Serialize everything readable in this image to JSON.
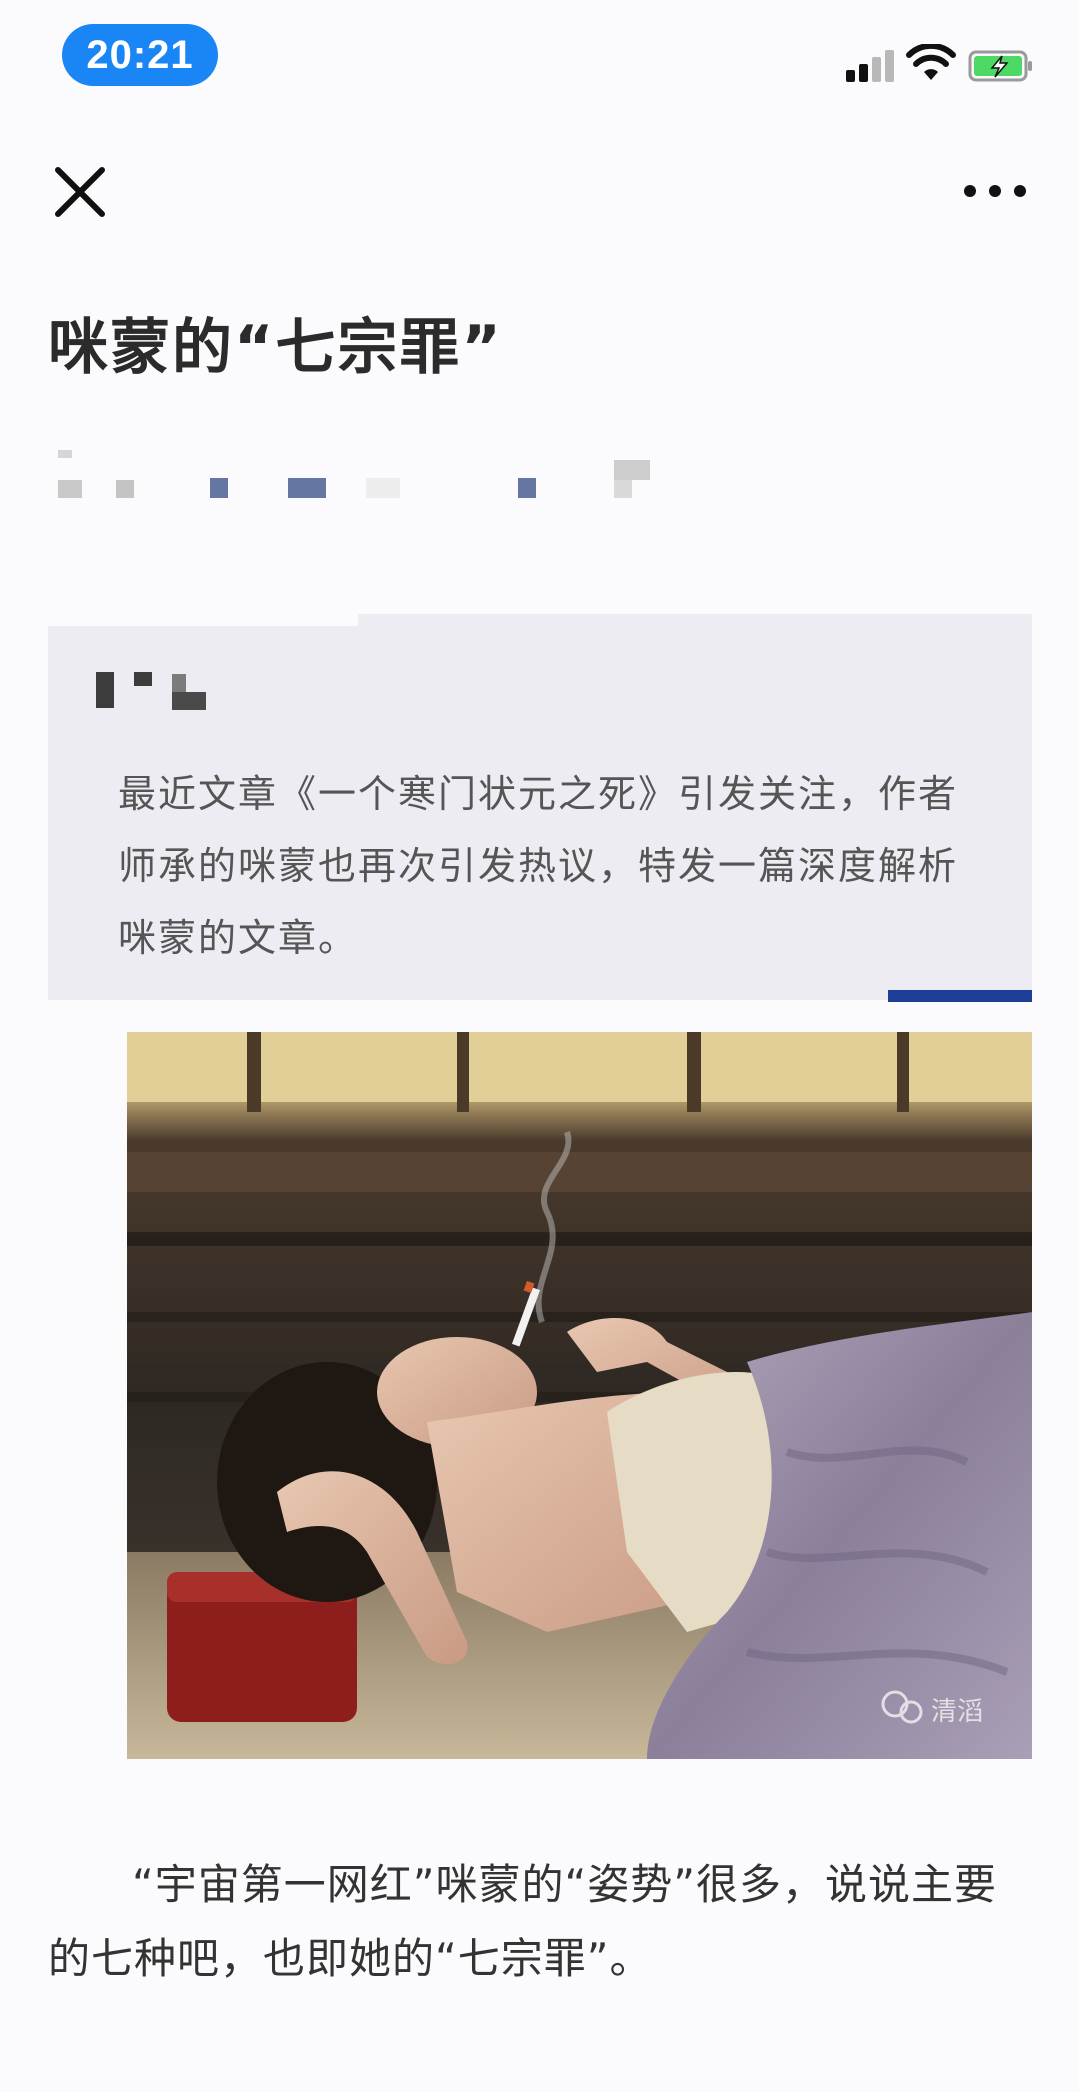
{
  "status_bar": {
    "time": "20:21",
    "time_pill_color": "#1a86f5",
    "icons": [
      "cellular-signal-icon",
      "wifi-icon",
      "battery-charging-icon"
    ]
  },
  "nav": {
    "close_icon": "close-icon",
    "more_icon": "more-dots-icon"
  },
  "article": {
    "title": "咪蒙的“七宗罪”",
    "quote": "最近文章《一个寒门状元之死》引发关注，作者师承的咪蒙也再次引发热议，特发一篇深度解析咪蒙的文章。",
    "image_watermark": "清滔",
    "body": "“宇宙第一网红”咪蒙的“姿势”很多，说说主要的七种吧，也即她的“七宗罪”。"
  },
  "colors": {
    "accent": "#1d3f9a",
    "quote_background": "#ececf2"
  }
}
